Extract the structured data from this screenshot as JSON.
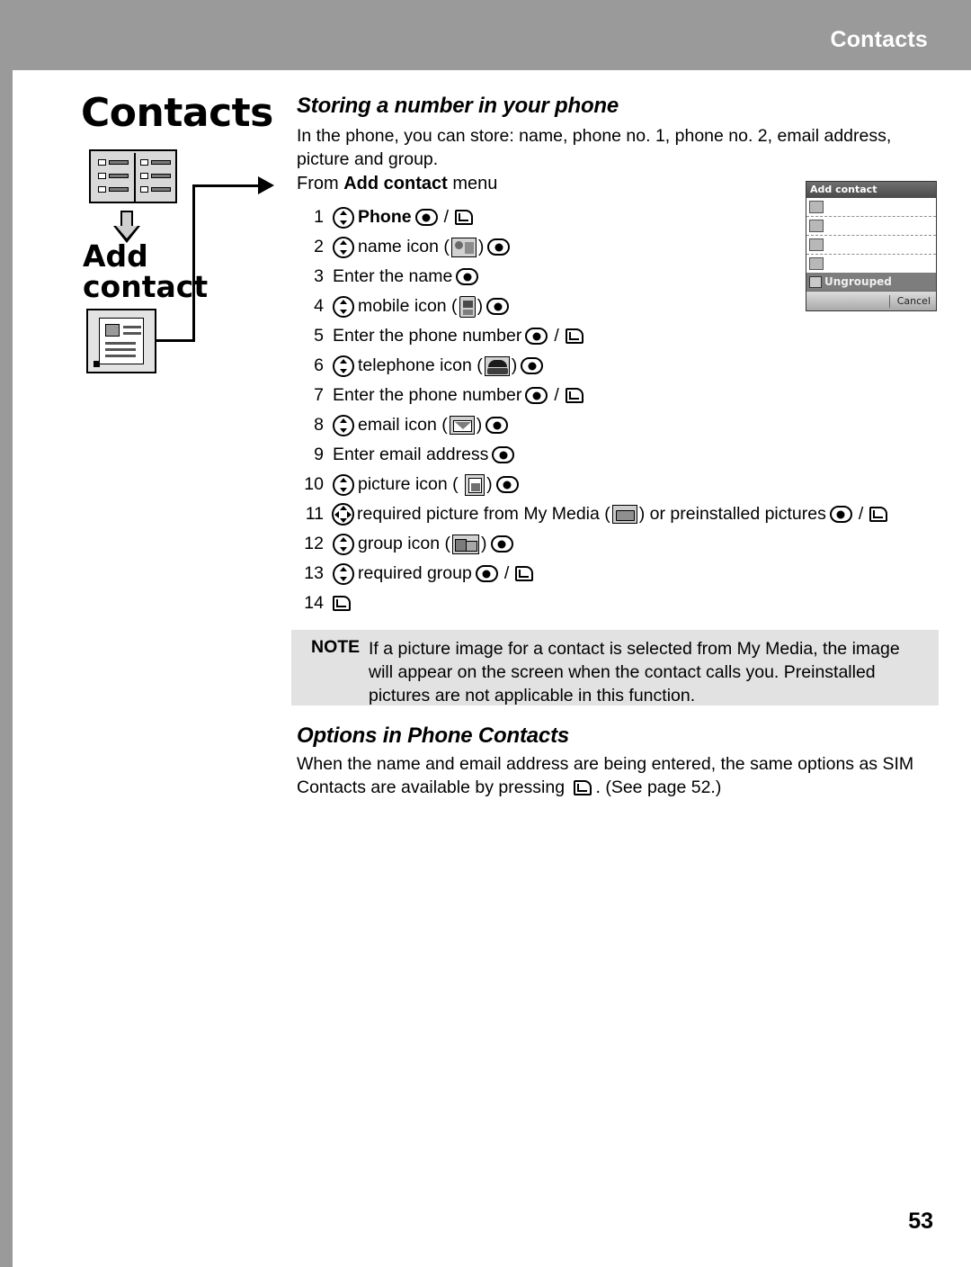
{
  "header": {
    "title": "Contacts"
  },
  "sidebar": {
    "chapter_title": "Contacts",
    "sub_title_line1": "Add",
    "sub_title_line2": "contact",
    "book_icon": "contacts-book-icon",
    "arrow_icon": "down-arrow-icon",
    "card_icon": "add-contact-card-icon"
  },
  "main": {
    "heading_storing": "Storing a number in your phone",
    "intro_paragraph": "In the phone, you can store: name, phone no. 1, phone no. 2, email address, picture and group.",
    "from_prefix": "From ",
    "from_bold": "Add contact",
    "from_suffix": " menu",
    "steps": [
      {
        "num": "1",
        "text": "Phone",
        "bold": true
      },
      {
        "num": "2",
        "text": "name icon"
      },
      {
        "num": "3",
        "text": "Enter the name"
      },
      {
        "num": "4",
        "text": "mobile icon"
      },
      {
        "num": "5",
        "text": "Enter the phone number"
      },
      {
        "num": "6",
        "text": "telephone icon"
      },
      {
        "num": "7",
        "text": "Enter the phone number"
      },
      {
        "num": "8",
        "text": "email icon"
      },
      {
        "num": "9",
        "text": "Enter email address"
      },
      {
        "num": "10",
        "text": "picture icon"
      },
      {
        "num": "11",
        "text_a": "required picture from My Media (",
        "text_b": ") or preinstalled pictures"
      },
      {
        "num": "12",
        "text": "group icon"
      },
      {
        "num": "13",
        "text": "required group"
      },
      {
        "num": "14",
        "text": ""
      }
    ],
    "note": {
      "label": "NOTE",
      "text": "If a picture image for a contact is selected from My Media, the image will appear on the screen when the contact calls you. Preinstalled pictures are not applicable in this function."
    },
    "heading_options": "Options in Phone Contacts",
    "options_paragraph_a": "When the name and email address are being entered, the same options as SIM Contacts are available by pressing ",
    "options_paragraph_b": ". (See page 52.)"
  },
  "phone_screenshot": {
    "title": "Add contact",
    "group_label": "Ungrouped",
    "softkey_right": "Cancel"
  },
  "footer": {
    "page_number": "53"
  },
  "colors": {
    "band": "#9a9a9a",
    "note_bg": "#e2e2e2",
    "text": "#000000"
  }
}
